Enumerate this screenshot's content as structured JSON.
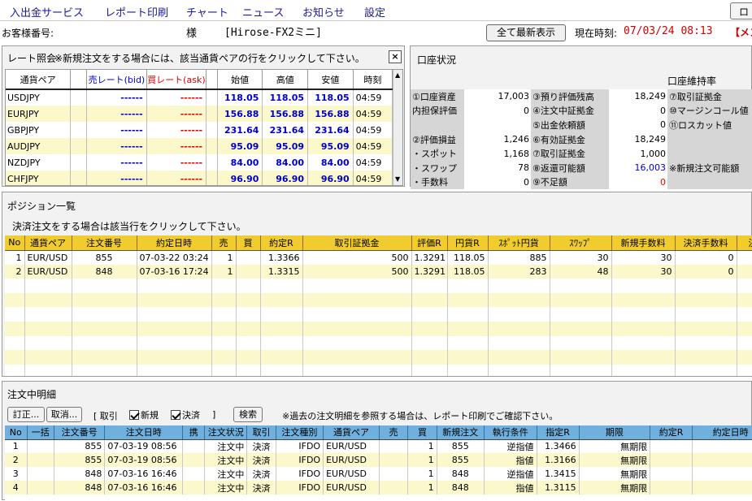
{
  "menu": {
    "items": [
      "入出金サービス",
      "レポート印刷",
      "チャート",
      "ニュース",
      "お知らせ",
      "設定"
    ],
    "login_partial": "ロ"
  },
  "info": {
    "customer_label": "お客様番号:",
    "sama": "様",
    "account_name": "[Hirose-FX2ミニ]",
    "refresh_button": "全て最新表示",
    "time_label": "現在時刻:",
    "time_value": "07/03/24 08:13",
    "alert_partial": "【メン"
  },
  "rate_panel": {
    "title": "レート照会",
    "note": "※新規注文をする場合には、該当通貨ペアの行をクリックして下さい。",
    "close_icon": "×",
    "headers": [
      "通貨ペア",
      "売レート(bid)",
      "買レート(ask)",
      "始値",
      "高値",
      "安値",
      "時刻"
    ],
    "rows": [
      {
        "pair": "USDJPY",
        "bid": "------",
        "ask": "------",
        "open": "118.05",
        "high": "118.05",
        "low": "118.05",
        "time": "04:59"
      },
      {
        "pair": "EURJPY",
        "bid": "------",
        "ask": "------",
        "open": "156.88",
        "high": "156.88",
        "low": "156.88",
        "time": "04:59"
      },
      {
        "pair": "GBPJPY",
        "bid": "------",
        "ask": "------",
        "open": "231.64",
        "high": "231.64",
        "low": "231.64",
        "time": "04:59"
      },
      {
        "pair": "AUDJPY",
        "bid": "------",
        "ask": "------",
        "open": "95.09",
        "high": "95.09",
        "low": "95.09",
        "time": "04:59"
      },
      {
        "pair": "NZDJPY",
        "bid": "------",
        "ask": "------",
        "open": "84.00",
        "high": "84.00",
        "low": "84.00",
        "time": "04:59"
      },
      {
        "pair": "CHFJPY",
        "bid": "------",
        "ask": "------",
        "open": "96.90",
        "high": "96.90",
        "low": "96.90",
        "time": "04:59"
      }
    ]
  },
  "account_panel": {
    "title": "口座状況",
    "maintenance_label": "口座維持率",
    "rows": [
      {
        "l1": "①口座資産",
        "v1": "17,003",
        "l2": "③預り評価残高",
        "v2": "18,249",
        "l3": "⑦取引証拠金"
      },
      {
        "l1": "内担保評価",
        "v1": "0",
        "l2": "④注文中証拠金",
        "v2": "0",
        "l3": "⑩マージンコール値"
      },
      {
        "l1": "",
        "v1": "",
        "l2": "⑤出金依頼額",
        "v2": "0",
        "l3": "⑪ロスカット値"
      },
      {
        "l1": "②評価損益",
        "v1": "1,246",
        "l2": "⑥有効証拠金",
        "v2": "18,249",
        "l3": ""
      },
      {
        "l1": "・スポット",
        "v1": "1,168",
        "l2": "⑦取引証拠金",
        "v2": "1,000",
        "l3": ""
      },
      {
        "l1": "・スワップ",
        "v1": "78",
        "l2": "⑧返還可能額",
        "v2": "16,003",
        "l3": "※新規注文可能額"
      },
      {
        "l1": "・手数料",
        "v1": "0",
        "l2": "⑨不足額",
        "v2": "0",
        "l3": ""
      }
    ]
  },
  "positions": {
    "title": "ポジション一覧",
    "note": "決済注文をする場合は該当行をクリックして下さい。",
    "headers": [
      "No",
      "通貨ペア",
      "注文番号",
      "約定日時",
      "売",
      "買",
      "約定R",
      "取引証拠金",
      "評価R",
      "円貨R",
      "ｽﾎﾟｯﾄ円貨",
      "ｽﾜｯﾌﾟ",
      "新規手数料",
      "決済手数料",
      "決"
    ],
    "rows": [
      [
        "1",
        "EUR/USD",
        "855",
        "07-03-22 03:24",
        "1",
        "",
        "1.3366",
        "500",
        "1.3291",
        "118.05",
        "885",
        "30",
        "30",
        "0",
        ""
      ],
      [
        "2",
        "EUR/USD",
        "848",
        "07-03-16 17:24",
        "1",
        "",
        "1.3315",
        "500",
        "1.3291",
        "118.05",
        "283",
        "48",
        "30",
        "0",
        ""
      ]
    ]
  },
  "orders": {
    "title": "注文中明細",
    "correct_button": "訂正...",
    "cancel_button": "取消...",
    "filter_torihiki": "[ 取引",
    "filter_new": "新規",
    "filter_settle": "決済",
    "filter_close": "]",
    "search_button": "検索",
    "note": "※過去の注文明細を参照する場合は、レポート印刷でご確認下さい。",
    "headers": [
      "No",
      "一括",
      "注文番号",
      "注文日時",
      "携",
      "注文状況",
      "取引",
      "注文種別",
      "通貨ペア",
      "売",
      "買",
      "新規注文",
      "執行条件",
      "指定R",
      "期限",
      "約定R",
      "約定日時"
    ],
    "rows": [
      [
        "1",
        "",
        "855",
        "07-03-19 08:56",
        "",
        "注文中",
        "決済",
        "IFDO",
        "EUR/USD",
        "",
        "1",
        "855",
        "逆指値",
        "1.3466",
        "無期限",
        "",
        ""
      ],
      [
        "2",
        "",
        "855",
        "07-03-19 08:56",
        "",
        "注文中",
        "決済",
        "IFDO",
        "EUR/USD",
        "",
        "1",
        "855",
        "指値",
        "1.3166",
        "無期限",
        "",
        ""
      ],
      [
        "3",
        "",
        "848",
        "07-03-16 16:46",
        "",
        "注文中",
        "決済",
        "IFDO",
        "EUR/USD",
        "",
        "1",
        "848",
        "逆指値",
        "1.3415",
        "無期限",
        "",
        ""
      ],
      [
        "4",
        "",
        "848",
        "07-03-16 16:46",
        "",
        "注文中",
        "決済",
        "IFDO",
        "EUR/USD",
        "",
        "1",
        "848",
        "指値",
        "1.3115",
        "無期限",
        "",
        ""
      ]
    ]
  },
  "colors": {
    "menu_text": "#1a1a9c",
    "time_red": "#d00000",
    "rate_blue": "#0000cc",
    "ask_red": "#ee0000",
    "position_header": "#f1cc2e",
    "order_header": "#6fb0de",
    "stripe": "#fbf8cc"
  }
}
